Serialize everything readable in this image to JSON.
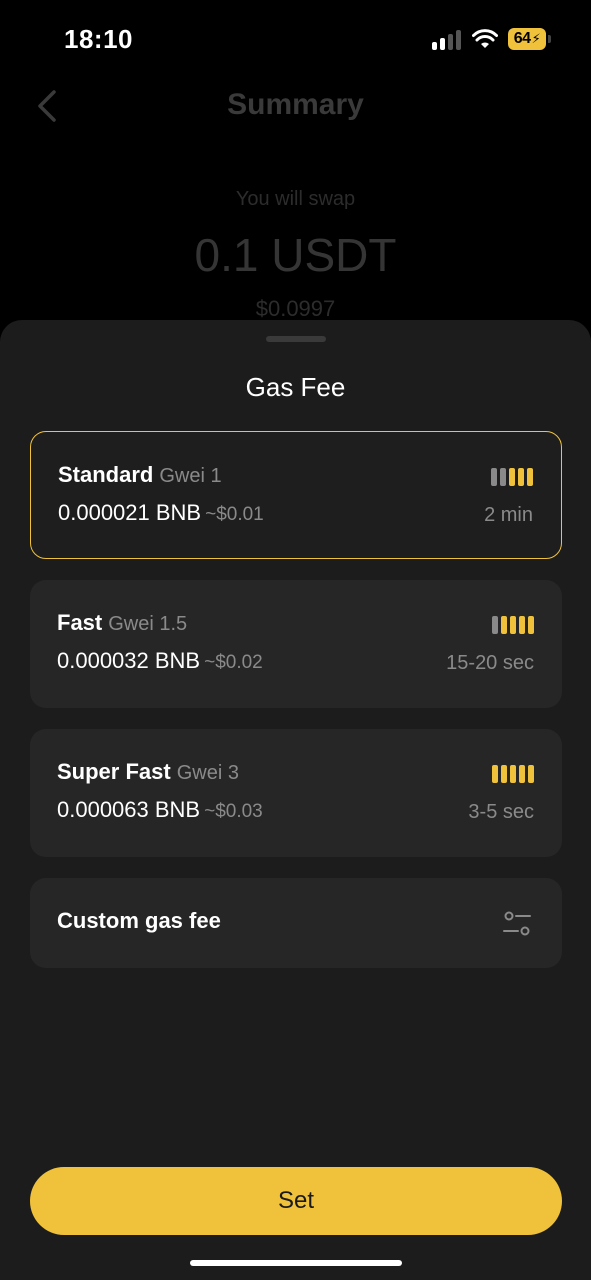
{
  "status_bar": {
    "time": "18:10",
    "battery": "64",
    "signal_icon": "cellular-signal-icon",
    "wifi_icon": "wifi-icon"
  },
  "background_page": {
    "title": "Summary",
    "back_icon": "chevron-left-icon",
    "swap_label": "You will swap",
    "swap_amount": "0.1 USDT",
    "swap_usd": "$0.0997"
  },
  "sheet": {
    "title": "Gas Fee",
    "options": [
      {
        "name": "Standard",
        "gwei": "Gwei 1",
        "amount": "0.000021 BNB",
        "usd": "~$0.01",
        "time": "2 min",
        "speed_level": 3,
        "speed_max": 5,
        "selected": true
      },
      {
        "name": "Fast",
        "gwei": "Gwei 1.5",
        "amount": "0.000032 BNB",
        "usd": "~$0.02",
        "time": "15-20 sec",
        "speed_level": 4,
        "speed_max": 5,
        "selected": false
      },
      {
        "name": "Super Fast",
        "gwei": "Gwei 3",
        "amount": "0.000063 BNB",
        "usd": "~$0.03",
        "time": "3-5 sec",
        "speed_level": 5,
        "speed_max": 5,
        "selected": false
      }
    ],
    "custom": {
      "label": "Custom gas fee",
      "icon": "sliders-icon"
    },
    "set_button": "Set"
  },
  "colors": {
    "accent": "#f0c23c",
    "sheet_bg": "#1c1c1c",
    "card_bg": "#262626",
    "muted_text": "#8a8a8a"
  }
}
